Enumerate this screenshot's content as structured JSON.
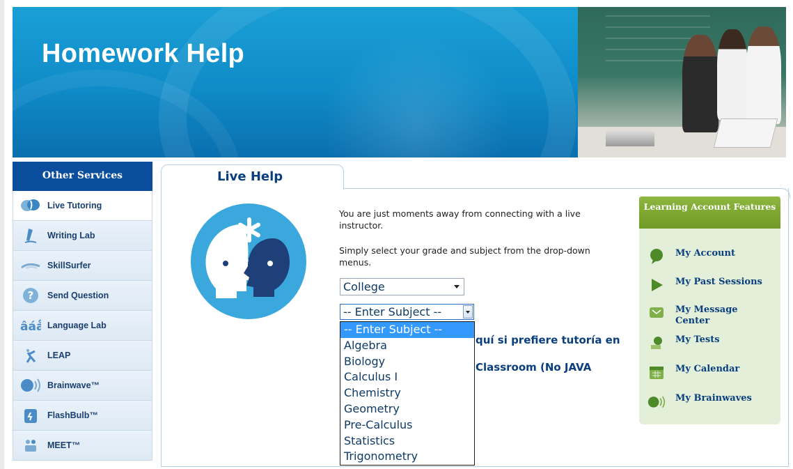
{
  "banner": {
    "title": "Homework Help"
  },
  "sidebar": {
    "header": "Other Services",
    "items": [
      {
        "label": "Live Tutoring",
        "icon": "chat-heads-icon"
      },
      {
        "label": "Writing Lab",
        "icon": "pen-icon"
      },
      {
        "label": "SkillSurfer",
        "icon": "surfer-icon"
      },
      {
        "label": "Send Question",
        "icon": "question-icon"
      },
      {
        "label": "Language Lab",
        "icon": "accented-letters-icon"
      },
      {
        "label": "LEAP",
        "icon": "leap-icon"
      },
      {
        "label": "Brainwave™",
        "icon": "brainwave-icon"
      },
      {
        "label": "FlashBulb™",
        "icon": "flashbulb-icon"
      },
      {
        "label": "MEET™",
        "icon": "meet-icon"
      }
    ]
  },
  "main": {
    "tab_label": "Live Help",
    "intro_1": "You are just moments away from connecting with a live instructor.",
    "intro_2": "Simply select your grade and subject from the drop-down menus.",
    "grade_select": {
      "value": "College"
    },
    "subject_select": {
      "value": "-- Enter Subject --",
      "options": [
        "-- Enter Subject --",
        "Algebra",
        "Biology",
        "Calculus I",
        "Chemistry",
        "Geometry",
        "Pre-Calculus",
        "Statistics",
        "Trigonometry"
      ]
    },
    "obscured_link_1": "quí si prefiere tutoría en",
    "obscured_link_2": "Classroom (No JAVA"
  },
  "features": {
    "header": "Learning Account Features",
    "items": [
      {
        "label": "My Account",
        "icon": "account-icon"
      },
      {
        "label": "My Past Sessions",
        "icon": "play-icon"
      },
      {
        "label": "My Message Center",
        "icon": "envelope-icon"
      },
      {
        "label": "My Tests",
        "icon": "tests-icon"
      },
      {
        "label": "My Calendar",
        "icon": "calendar-icon"
      },
      {
        "label": "My Brainwaves",
        "icon": "brainwave-icon"
      }
    ]
  },
  "colors": {
    "banner_blue": "#1a9fd6",
    "nav_header": "#0a4d9c",
    "link_blue": "#0a3f7f",
    "feature_green": "#7ea832",
    "feature_bg": "#e3efd8",
    "selected_option": "#3399ff"
  }
}
